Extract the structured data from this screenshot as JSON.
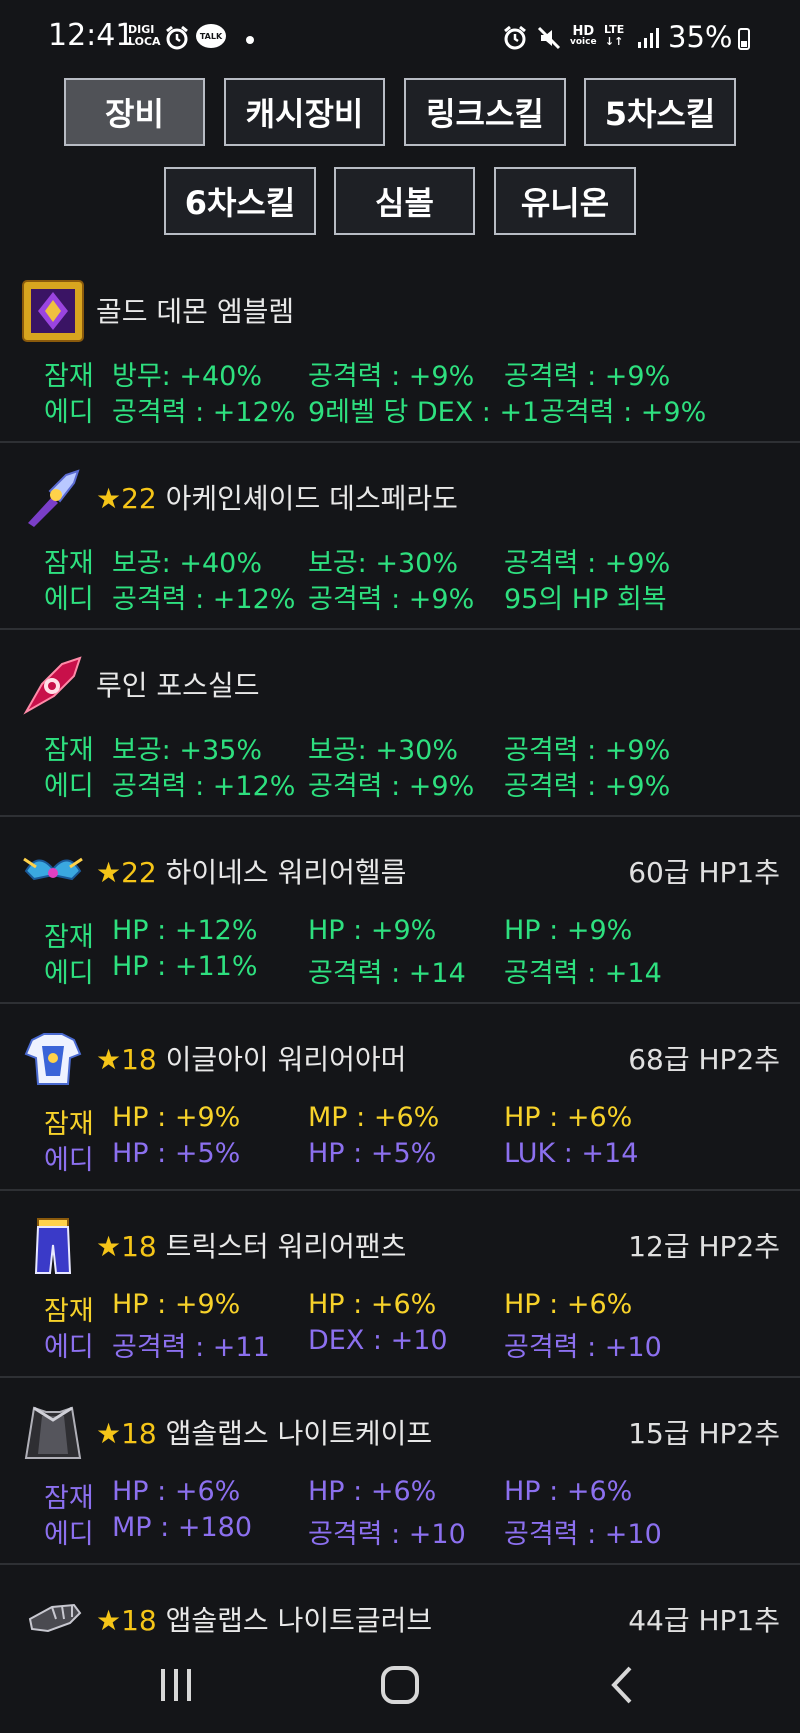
{
  "status": {
    "time": "12:41",
    "carrier_top": "DIGI",
    "carrier_bottom": "LOCA",
    "talk": "TALK",
    "hd_top": "HD",
    "hd_bottom": "voice",
    "lte": "LTE",
    "battery": "35%"
  },
  "tabs": [
    {
      "label": "장비",
      "active": true
    },
    {
      "label": "캐시장비",
      "active": false
    },
    {
      "label": "링크스킬",
      "active": false
    },
    {
      "label": "5차스킬",
      "active": false
    },
    {
      "label": "6차스킬",
      "active": false
    },
    {
      "label": "심볼",
      "active": false
    },
    {
      "label": "유니온",
      "active": false
    }
  ],
  "labels": {
    "potential": "잠재",
    "additional": "에디"
  },
  "items": [
    {
      "star": "",
      "name": "골드 데몬 엠블렘",
      "rank": "",
      "potential": [
        "방무: +40%",
        "공격력 : +9%",
        "공격력 : +9%"
      ],
      "additional": [
        "공격력 : +12%",
        "9레벨 당 DEX : +1",
        "공격력 : +9%"
      ],
      "potential_color": "#2ee07f",
      "additional_color": "#2ee07f"
    },
    {
      "star": "★22",
      "name": "아케인셰이드 데스페라도",
      "rank": "",
      "potential": [
        "보공: +40%",
        "보공: +30%",
        "공격력 : +9%"
      ],
      "additional": [
        "공격력 : +12%",
        "공격력 : +9%",
        "95의 HP 회복"
      ],
      "potential_color": "#2ee07f",
      "additional_color": "#2ee07f"
    },
    {
      "star": "",
      "name": "루인 포스실드",
      "rank": "",
      "potential": [
        "보공: +35%",
        "보공: +30%",
        "공격력 : +9%"
      ],
      "additional": [
        "공격력 : +12%",
        "공격력 : +9%",
        "공격력 : +9%"
      ],
      "potential_color": "#2ee07f",
      "additional_color": "#2ee07f"
    },
    {
      "star": "★22",
      "name": "하이네스 워리어헬름",
      "rank": "60급 HP1추",
      "potential": [
        "HP : +12%",
        "HP : +9%",
        "HP : +9%"
      ],
      "additional": [
        "HP : +11%",
        "공격력 : +14",
        "공격력 : +14"
      ],
      "potential_color": "#2ee07f",
      "additional_color": "#2ee07f"
    },
    {
      "star": "★18",
      "name": "이글아이 워리어아머",
      "rank": "68급 HP2추",
      "potential": [
        "HP : +9%",
        "MP : +6%",
        "HP : +6%"
      ],
      "additional": [
        "HP : +5%",
        "HP : +5%",
        "LUK : +14"
      ],
      "potential_color": "#f7d22a",
      "additional_color": "#8c70ef"
    },
    {
      "star": "★18",
      "name": "트릭스터 워리어팬츠",
      "rank": "12급 HP2추",
      "potential": [
        "HP : +9%",
        "HP : +6%",
        "HP : +6%"
      ],
      "additional": [
        "공격력 : +11",
        "DEX : +10",
        "공격력 : +10"
      ],
      "potential_color": "#f7d22a",
      "additional_color": "#8c70ef"
    },
    {
      "star": "★18",
      "name": "앱솔랩스 나이트케이프",
      "rank": "15급 HP2추",
      "potential": [
        "HP : +6%",
        "HP : +6%",
        "HP : +6%"
      ],
      "additional": [
        "MP : +180",
        "공격력 : +10",
        "공격력 : +10"
      ],
      "potential_color": "#8c70ef",
      "additional_color": "#8c70ef"
    },
    {
      "star": "★18",
      "name": "앱솔랩스 나이트글러브",
      "rank": "44급 HP1추",
      "potential": [],
      "additional": [],
      "potential_color": "#8c70ef",
      "additional_color": "#8c70ef"
    }
  ],
  "icons": [
    "emblem-icon",
    "desperado-icon",
    "force-shield-icon",
    "helm-icon",
    "armor-icon",
    "pants-icon",
    "cape-icon",
    "glove-icon"
  ],
  "nav": {
    "recents": "recents-icon",
    "home": "home-icon",
    "back": "back-icon"
  }
}
